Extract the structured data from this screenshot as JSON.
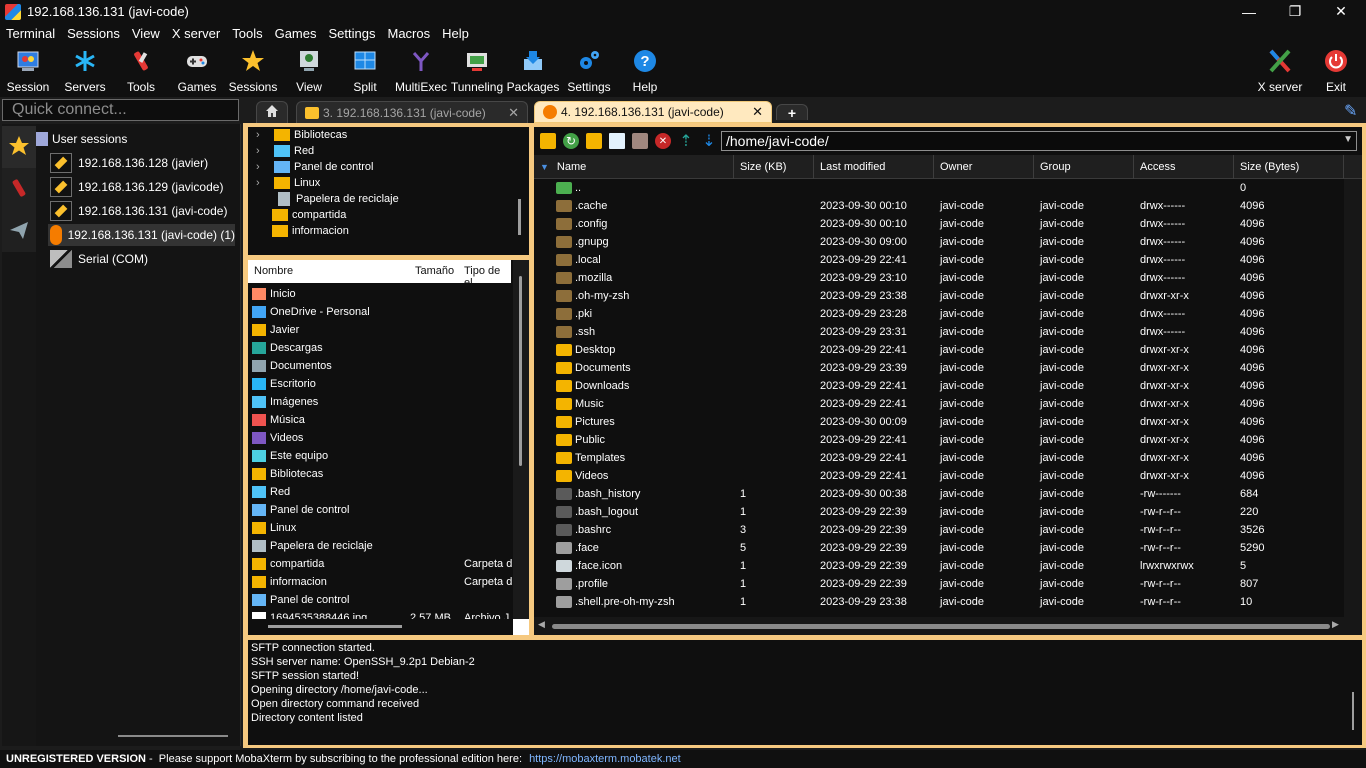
{
  "window": {
    "title": "192.168.136.131 (javi-code)",
    "controls": {
      "minimize": "—",
      "maximize": "❐",
      "close": "✕"
    }
  },
  "menu": [
    "Terminal",
    "Sessions",
    "View",
    "X server",
    "Tools",
    "Games",
    "Settings",
    "Macros",
    "Help"
  ],
  "toolbar": {
    "buttons": [
      {
        "label": "Session",
        "icon": "session-icon"
      },
      {
        "label": "Servers",
        "icon": "servers-icon"
      },
      {
        "label": "Tools",
        "icon": "tools-icon"
      },
      {
        "label": "Games",
        "icon": "games-icon"
      },
      {
        "label": "Sessions",
        "icon": "star-icon"
      },
      {
        "label": "View",
        "icon": "view-icon"
      },
      {
        "label": "Split",
        "icon": "split-icon"
      },
      {
        "label": "MultiExec",
        "icon": "multiexec-icon"
      },
      {
        "label": "Tunneling",
        "icon": "tunneling-icon"
      },
      {
        "label": "Packages",
        "icon": "packages-icon"
      },
      {
        "label": "Settings",
        "icon": "settings-icon"
      },
      {
        "label": "Help",
        "icon": "help-icon"
      }
    ],
    "xserver": "X server",
    "exit": "Exit"
  },
  "quick_connect": {
    "placeholder": "Quick connect..."
  },
  "tabs": [
    {
      "label": "3. 192.168.136.131 (javi-code)",
      "active": false
    },
    {
      "label": "4. 192.168.136.131 (javi-code)",
      "active": true
    }
  ],
  "sessions_panel": {
    "root": "User sessions",
    "items": [
      "192.168.136.128 (javier)",
      "192.168.136.129 (javicode)",
      "192.168.136.131 (javi-code)",
      "192.168.136.131 (javi-code) (1)",
      "Serial (COM)"
    ]
  },
  "local_tree": [
    "Bibliotecas",
    "Red",
    "Panel de control",
    "Linux",
    "Papelera de reciclaje",
    "compartida",
    "informacion"
  ],
  "local_browser": {
    "columns": [
      "Nombre",
      "Tamaño",
      "Tipo de el"
    ],
    "rows": [
      {
        "name": "Inicio",
        "size": "",
        "type": ""
      },
      {
        "name": "OneDrive - Personal",
        "size": "",
        "type": ""
      },
      {
        "name": "Javier",
        "size": "",
        "type": ""
      },
      {
        "name": "Descargas",
        "size": "",
        "type": ""
      },
      {
        "name": "Documentos",
        "size": "",
        "type": ""
      },
      {
        "name": "Escritorio",
        "size": "",
        "type": ""
      },
      {
        "name": "Imágenes",
        "size": "",
        "type": ""
      },
      {
        "name": "Música",
        "size": "",
        "type": ""
      },
      {
        "name": "Videos",
        "size": "",
        "type": ""
      },
      {
        "name": "Este equipo",
        "size": "",
        "type": ""
      },
      {
        "name": "Bibliotecas",
        "size": "",
        "type": ""
      },
      {
        "name": "Red",
        "size": "",
        "type": ""
      },
      {
        "name": "Panel de control",
        "size": "",
        "type": ""
      },
      {
        "name": "Linux",
        "size": "",
        "type": ""
      },
      {
        "name": "Papelera de reciclaje",
        "size": "",
        "type": ""
      },
      {
        "name": "compartida",
        "size": "",
        "type": "Carpeta d"
      },
      {
        "name": "informacion",
        "size": "",
        "type": "Carpeta d"
      },
      {
        "name": "Panel de control",
        "size": "",
        "type": ""
      },
      {
        "name": "1694535388446.jpg",
        "size": "2.57 MB",
        "type": "Archivo J"
      }
    ]
  },
  "remote": {
    "path": "/home/javi-code/",
    "columns": [
      "Name",
      "Size (KB)",
      "Last modified",
      "Owner",
      "Group",
      "Access",
      "Size (Bytes)"
    ],
    "rows": [
      {
        "name": "..",
        "kb": "",
        "modified": "",
        "owner": "",
        "group": "",
        "access": "",
        "bytes": "0",
        "kind": "up"
      },
      {
        "name": ".cache",
        "kb": "",
        "modified": "2023-09-30 00:10",
        "owner": "javi-code",
        "group": "javi-code",
        "access": "drwx------",
        "bytes": "4096",
        "kind": "hidden-folder"
      },
      {
        "name": ".config",
        "kb": "",
        "modified": "2023-09-30 00:10",
        "owner": "javi-code",
        "group": "javi-code",
        "access": "drwx------",
        "bytes": "4096",
        "kind": "hidden-folder"
      },
      {
        "name": ".gnupg",
        "kb": "",
        "modified": "2023-09-30 09:00",
        "owner": "javi-code",
        "group": "javi-code",
        "access": "drwx------",
        "bytes": "4096",
        "kind": "hidden-folder"
      },
      {
        "name": ".local",
        "kb": "",
        "modified": "2023-09-29 22:41",
        "owner": "javi-code",
        "group": "javi-code",
        "access": "drwx------",
        "bytes": "4096",
        "kind": "hidden-folder"
      },
      {
        "name": ".mozilla",
        "kb": "",
        "modified": "2023-09-29 23:10",
        "owner": "javi-code",
        "group": "javi-code",
        "access": "drwx------",
        "bytes": "4096",
        "kind": "hidden-folder"
      },
      {
        "name": ".oh-my-zsh",
        "kb": "",
        "modified": "2023-09-29 23:38",
        "owner": "javi-code",
        "group": "javi-code",
        "access": "drwxr-xr-x",
        "bytes": "4096",
        "kind": "hidden-folder"
      },
      {
        "name": ".pki",
        "kb": "",
        "modified": "2023-09-29 23:28",
        "owner": "javi-code",
        "group": "javi-code",
        "access": "drwx------",
        "bytes": "4096",
        "kind": "hidden-folder"
      },
      {
        "name": ".ssh",
        "kb": "",
        "modified": "2023-09-29 23:31",
        "owner": "javi-code",
        "group": "javi-code",
        "access": "drwx------",
        "bytes": "4096",
        "kind": "hidden-folder"
      },
      {
        "name": "Desktop",
        "kb": "",
        "modified": "2023-09-29 22:41",
        "owner": "javi-code",
        "group": "javi-code",
        "access": "drwxr-xr-x",
        "bytes": "4096",
        "kind": "folder"
      },
      {
        "name": "Documents",
        "kb": "",
        "modified": "2023-09-29 23:39",
        "owner": "javi-code",
        "group": "javi-code",
        "access": "drwxr-xr-x",
        "bytes": "4096",
        "kind": "folder"
      },
      {
        "name": "Downloads",
        "kb": "",
        "modified": "2023-09-29 22:41",
        "owner": "javi-code",
        "group": "javi-code",
        "access": "drwxr-xr-x",
        "bytes": "4096",
        "kind": "folder"
      },
      {
        "name": "Music",
        "kb": "",
        "modified": "2023-09-29 22:41",
        "owner": "javi-code",
        "group": "javi-code",
        "access": "drwxr-xr-x",
        "bytes": "4096",
        "kind": "folder"
      },
      {
        "name": "Pictures",
        "kb": "",
        "modified": "2023-09-30 00:09",
        "owner": "javi-code",
        "group": "javi-code",
        "access": "drwxr-xr-x",
        "bytes": "4096",
        "kind": "folder"
      },
      {
        "name": "Public",
        "kb": "",
        "modified": "2023-09-29 22:41",
        "owner": "javi-code",
        "group": "javi-code",
        "access": "drwxr-xr-x",
        "bytes": "4096",
        "kind": "folder"
      },
      {
        "name": "Templates",
        "kb": "",
        "modified": "2023-09-29 22:41",
        "owner": "javi-code",
        "group": "javi-code",
        "access": "drwxr-xr-x",
        "bytes": "4096",
        "kind": "folder"
      },
      {
        "name": "Videos",
        "kb": "",
        "modified": "2023-09-29 22:41",
        "owner": "javi-code",
        "group": "javi-code",
        "access": "drwxr-xr-x",
        "bytes": "4096",
        "kind": "folder"
      },
      {
        "name": ".bash_history",
        "kb": "1",
        "modified": "2023-09-30 00:38",
        "owner": "javi-code",
        "group": "javi-code",
        "access": "-rw-------",
        "bytes": "684",
        "kind": "hidden-file"
      },
      {
        "name": ".bash_logout",
        "kb": "1",
        "modified": "2023-09-29 22:39",
        "owner": "javi-code",
        "group": "javi-code",
        "access": "-rw-r--r--",
        "bytes": "220",
        "kind": "hidden-file"
      },
      {
        "name": ".bashrc",
        "kb": "3",
        "modified": "2023-09-29 22:39",
        "owner": "javi-code",
        "group": "javi-code",
        "access": "-rw-r--r--",
        "bytes": "3526",
        "kind": "hidden-file"
      },
      {
        "name": ".face",
        "kb": "5",
        "modified": "2023-09-29 22:39",
        "owner": "javi-code",
        "group": "javi-code",
        "access": "-rw-r--r--",
        "bytes": "5290",
        "kind": "file"
      },
      {
        "name": ".face.icon",
        "kb": "1",
        "modified": "2023-09-29 22:39",
        "owner": "javi-code",
        "group": "javi-code",
        "access": "lrwxrwxrwx",
        "bytes": "5",
        "kind": "link"
      },
      {
        "name": ".profile",
        "kb": "1",
        "modified": "2023-09-29 22:39",
        "owner": "javi-code",
        "group": "javi-code",
        "access": "-rw-r--r--",
        "bytes": "807",
        "kind": "file"
      },
      {
        "name": ".shell.pre-oh-my-zsh",
        "kb": "1",
        "modified": "2023-09-29 23:38",
        "owner": "javi-code",
        "group": "javi-code",
        "access": "-rw-r--r--",
        "bytes": "10",
        "kind": "file"
      }
    ]
  },
  "log": [
    "SFTP connection started.",
    "SSH server name: OpenSSH_9.2p1 Debian-2",
    "SFTP session started!",
    "Opening directory /home/javi-code...",
    "Open directory command received",
    "Directory content listed"
  ],
  "status": {
    "unregistered": "UNREGISTERED VERSION",
    "message": " -  Please support MobaXterm by subscribing to the professional edition here: ",
    "link": "https://mobaxterm.mobatek.net"
  },
  "colors": {
    "accent": "#f6c980",
    "folder": "#f4b400",
    "link": "#7fb6ff",
    "background": "#1c1c1c"
  }
}
